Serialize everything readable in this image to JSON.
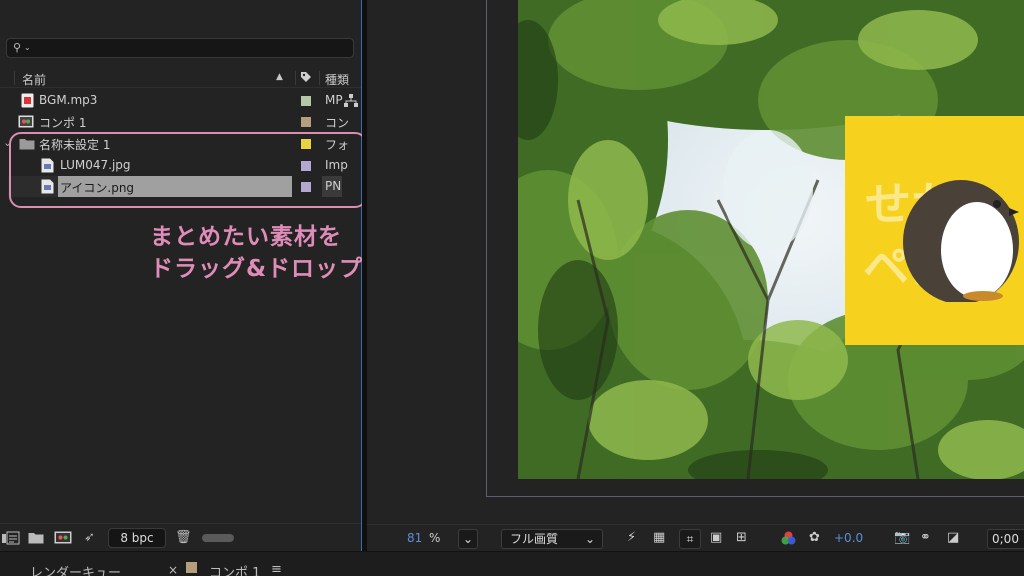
{
  "project": {
    "columns": {
      "name": "名前",
      "type": "種類"
    },
    "items": [
      {
        "name": "BGM.mp3",
        "type": "MP",
        "swatch": "#b4c8a8",
        "icon": "audio-file-icon"
      },
      {
        "name": "コンポ 1",
        "type": "コン",
        "swatch": "#b49e7c",
        "icon": "composition-icon"
      },
      {
        "name": "名称未設定 1",
        "type": "フォ",
        "swatch": "#e8d442",
        "icon": "folder-icon"
      },
      {
        "name": "LUM047.jpg",
        "type": "Imp",
        "swatch": "#b2a8d0",
        "icon": "image-file-icon"
      },
      {
        "name": "アイコン.png",
        "type": "PN",
        "swatch": "#b2a8d0",
        "icon": "image-file-icon"
      }
    ],
    "bpc": "8 bpc"
  },
  "annotation": {
    "line1": "まとめたい素材を",
    "line2": "ドラッグ&ドロップ",
    "color": "#e08cb8"
  },
  "viewer": {
    "zoom": "81",
    "zoom_unit": "%",
    "resolution": "フル画質",
    "exposure": "+0.0",
    "timecode": "0;00"
  },
  "tabs": {
    "render_queue": "レンダーキュー",
    "close": "×",
    "comp": "コンポ 1",
    "menu": "≡"
  },
  "colors": {
    "accent": "#5b8fd9",
    "panel_focus": "#3b6db3",
    "icon_yellow": "#f6d21f"
  }
}
